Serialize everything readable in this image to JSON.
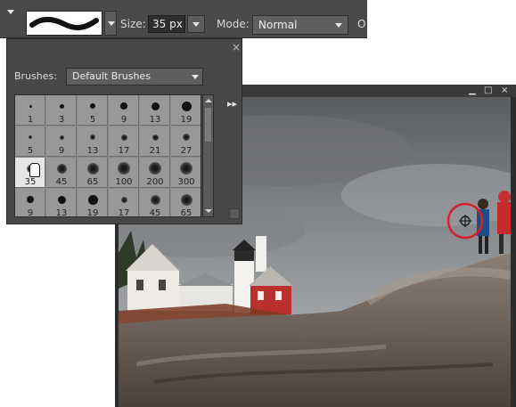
{
  "options_bar": {
    "size_label": "Size:",
    "size_value": "35 px",
    "mode_label": "Mode:",
    "mode_value": "Normal",
    "trailing_label": "O"
  },
  "brush_picker": {
    "brushes_label": "Brushes:",
    "brushes_value": "Default Brushes",
    "close_glyph": "×",
    "flyout_glyph": "▸▸",
    "presets": [
      {
        "label": "1",
        "style": "hard"
      },
      {
        "label": "3",
        "style": "hard"
      },
      {
        "label": "5",
        "style": "hard"
      },
      {
        "label": "9",
        "style": "hard"
      },
      {
        "label": "13",
        "style": "hard"
      },
      {
        "label": "19",
        "style": "hard"
      },
      {
        "label": "5",
        "style": "soft"
      },
      {
        "label": "9",
        "style": "soft"
      },
      {
        "label": "13",
        "style": "soft"
      },
      {
        "label": "17",
        "style": "soft"
      },
      {
        "label": "21",
        "style": "soft"
      },
      {
        "label": "27",
        "style": "soft"
      },
      {
        "label": "35",
        "style": "soft",
        "selected": true
      },
      {
        "label": "45",
        "style": "soft"
      },
      {
        "label": "65",
        "style": "soft"
      },
      {
        "label": "100",
        "style": "soft"
      },
      {
        "label": "200",
        "style": "soft"
      },
      {
        "label": "300",
        "style": "soft"
      },
      {
        "label": "9",
        "style": "hard"
      },
      {
        "label": "13",
        "style": "hard"
      },
      {
        "label": "19",
        "style": "hard"
      },
      {
        "label": "17",
        "style": "soft"
      },
      {
        "label": "45",
        "style": "soft"
      },
      {
        "label": "65",
        "style": "soft"
      }
    ]
  },
  "image_window": {
    "minimize_glyph": "▁",
    "restore_glyph": "□",
    "close_glyph": "×"
  },
  "colors": {
    "cursor_highlight": "#d8202a"
  }
}
